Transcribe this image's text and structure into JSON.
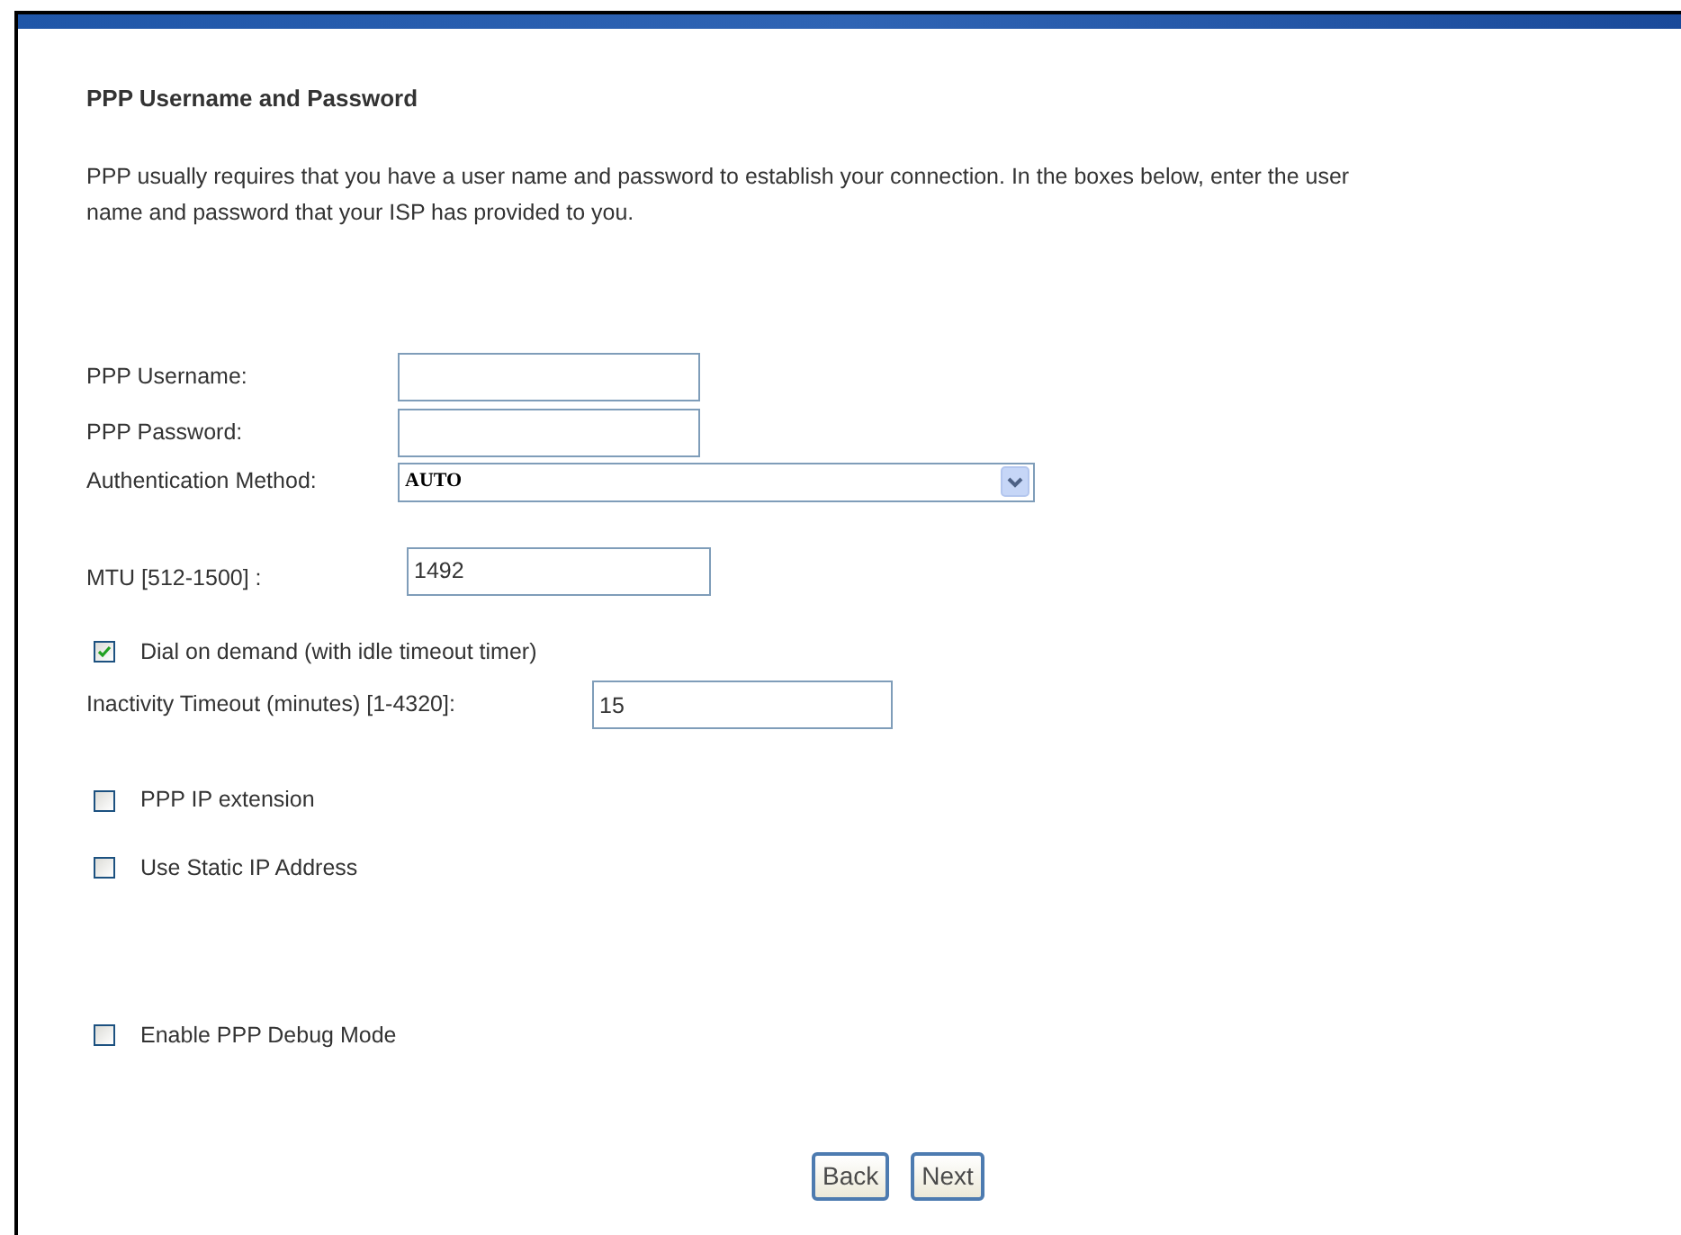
{
  "heading": "PPP Username and Password",
  "intro": "PPP usually requires that you have a user name and password to establish your connection. In the boxes below, enter the user\nname and password that your ISP has provided to you.",
  "username": {
    "label": "PPP Username:"
  },
  "password": {
    "label": "PPP Password:"
  },
  "auth_method": {
    "label": "Authentication Method:",
    "value": "AUTO"
  },
  "mtu": {
    "label": "MTU [512-1500] :",
    "value": "1492"
  },
  "dial_on_demand": {
    "label": "Dial on demand (with idle timeout timer)",
    "checked": true
  },
  "inactivity_timeout": {
    "label": "Inactivity Timeout (minutes) [1-4320]:",
    "value": "15"
  },
  "ppp_ip_extension": {
    "label": "PPP IP extension",
    "checked": false
  },
  "static_ip": {
    "label": "Use Static IP Address",
    "checked": false
  },
  "debug_mode": {
    "label": "Enable PPP Debug Mode",
    "checked": false
  },
  "buttons": [
    "Back",
    "Next"
  ]
}
